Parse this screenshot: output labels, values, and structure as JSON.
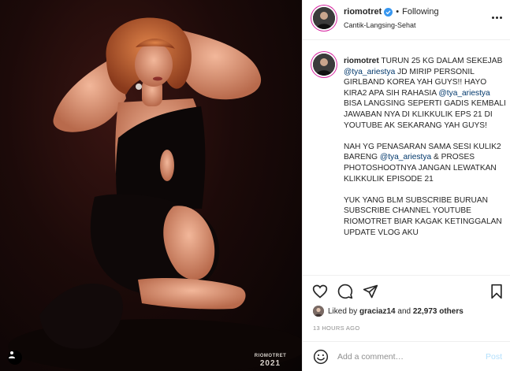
{
  "post": {
    "username": "riomotret",
    "verified": true,
    "follow_status": "Following",
    "location": "Cantik-Langsing-Sehat",
    "caption": {
      "username": "riomotret",
      "line1_before": "TURUN 25 KG DALAM SEKEJAB ",
      "mention1": "@tya_ariestya",
      "line1_after": " JD MIRIP PERSONIL GIRLBAND KOREA YAH GUYS!! HAYO KIRA2 APA SIH RAHASIA ",
      "mention2": "@tya_ariestya",
      "line1_end": " BISA LANGSING SEPERTI GADIS KEMBALI JAWABAN NYA DI KLIKKULIK EPS 21 DI YOUTUBE AK SEKARANG YAH GUYS!",
      "para2_before": "NAH YG PENASARAN SAMA SESI KULIK2 BARENG ",
      "mention3": "@tya_ariestya",
      "para2_after": " & PROSES PHOTOSHOOTNYA JANGAN LEWATKAN KLIKKULIK EPISODE 21",
      "para3": "YUK YANG BLM SUBSCRIBE BURUAN SUBSCRIBE CHANNEL YOUTUBE RIOMOTRET BIAR KAGAK KETINGGALAN UPDATE VLOG AKU"
    },
    "likes": {
      "prefix": "Liked by",
      "user": "graciaz14",
      "joiner": "and",
      "count": "22,973 others"
    },
    "timestamp": "13 HOURS AGO",
    "comment_placeholder": "Add a comment…",
    "post_label": "Post"
  },
  "photo": {
    "watermark_name": "RIOMOTRET",
    "watermark_year": "2021"
  },
  "icons": {
    "like": "heart-icon",
    "comment": "comment-icon",
    "share": "paper-plane-icon",
    "save": "bookmark-icon",
    "more": "more-options-icon",
    "emoji": "emoji-icon",
    "tag": "tagged-people-icon"
  },
  "colors": {
    "verified": "#3897f0",
    "mention": "#00376b",
    "post_button": "#b2dffc",
    "muted": "#8e8e8e"
  }
}
